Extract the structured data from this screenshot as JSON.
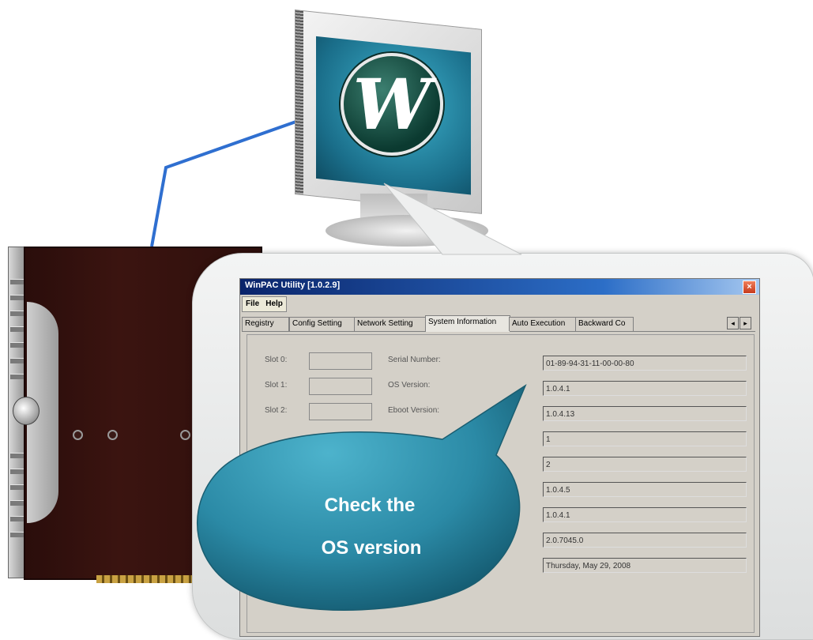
{
  "window": {
    "title": "WinPAC Utility [1.0.2.9]",
    "close_label": "×"
  },
  "menu": {
    "file": "File",
    "help": "Help"
  },
  "tabs": [
    {
      "label": "Registry"
    },
    {
      "label": "Config Setting"
    },
    {
      "label": "Network Setting"
    },
    {
      "label": "System Information"
    },
    {
      "label": "Auto Execution"
    },
    {
      "label": "Backward Co"
    }
  ],
  "tab_scroll": {
    "left": "◂",
    "right": "▸"
  },
  "slots": [
    {
      "label": "Slot 0:"
    },
    {
      "label": "Slot 1:"
    },
    {
      "label": "Slot 2:"
    }
  ],
  "info_labels": {
    "serial": "Serial Number:",
    "os": "OS Version:",
    "eboot": "Eboot Version:"
  },
  "info_values": [
    "01-89-94-31-11-00-00-80",
    "1.0.4.1",
    "1.0.4.13",
    "1",
    "2",
    "1.0.4.5",
    "1.0.4.1",
    "2.0.7045.0",
    "Thursday, May 29, 2008"
  ],
  "callout": {
    "line1": "Check the",
    "line2": "OS version"
  },
  "logo_letter": "W",
  "colors": {
    "bubble": "#2b8aa6",
    "titlebar": "#0a246a",
    "cable": "#2f6fd0"
  }
}
